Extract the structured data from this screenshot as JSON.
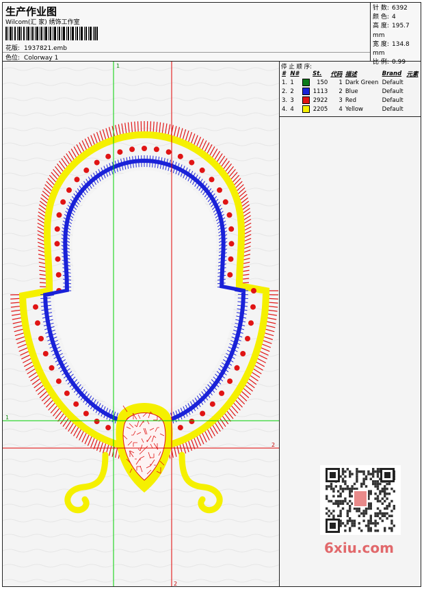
{
  "header": {
    "title": "生产作业图",
    "company": "Wilcom(汇 家) 绣饰工作室",
    "design_label": "花版:",
    "design_value": "1937821.emb",
    "colorway_label": "色位:",
    "colorway_value": "Colorway 1"
  },
  "stats": {
    "stitches_label": "针 数:",
    "stitches_value": "6392",
    "colors_label": "颜 色:",
    "colors_value": "4",
    "height_label": "高 度:",
    "height_value": "195.7 mm",
    "width_label": "宽 度:",
    "width_value": "134.8 mm",
    "scale_label": "比 例:",
    "scale_value": "0.99"
  },
  "stop_sequence": {
    "title": "停 止 顺 序:",
    "columns": [
      "#",
      "N#",
      "St.",
      "代码",
      "描述",
      "Brand",
      "元素"
    ],
    "rows": [
      {
        "idx": "1.",
        "n": "1",
        "color": "#0b7a1a",
        "st": "150",
        "code": "1",
        "desc": "Dark Green",
        "brand": "Default"
      },
      {
        "idx": "2.",
        "n": "2",
        "color": "#1a22d8",
        "st": "1113",
        "code": "2",
        "desc": "Blue",
        "brand": "Default"
      },
      {
        "idx": "3.",
        "n": "3",
        "color": "#e01414",
        "st": "2922",
        "code": "3",
        "desc": "Red",
        "brand": "Default"
      },
      {
        "idx": "4.",
        "n": "4",
        "color": "#f5f000",
        "st": "2205",
        "code": "4",
        "desc": "Yellow",
        "brand": "Default"
      }
    ]
  },
  "guides": {
    "v1_label": "1",
    "v2_label": "2",
    "h1_label": "1",
    "h2_label": "2",
    "guide_green": "#00d000",
    "guide_red": "#e00000"
  },
  "thread_colors": {
    "red": "#e01414",
    "yellow": "#f5f000",
    "blue": "#1a22d8"
  },
  "watermark": {
    "text": "6xiu.com",
    "color": "#e1686b"
  }
}
